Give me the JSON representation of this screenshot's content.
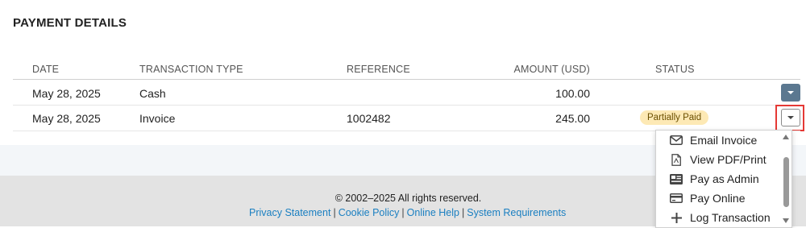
{
  "section_title": "PAYMENT DETAILS",
  "table": {
    "headers": {
      "date": "DATE",
      "transaction_type": "TRANSACTION TYPE",
      "reference": "REFERENCE",
      "amount": "AMOUNT (USD)",
      "status": "STATUS"
    },
    "rows": [
      {
        "date": "May 28, 2025",
        "transaction_type": "Cash",
        "reference": "",
        "amount": "100.00",
        "status": ""
      },
      {
        "date": "May 28, 2025",
        "transaction_type": "Invoice",
        "reference": "1002482",
        "amount": "245.00",
        "status": "Partially Paid"
      }
    ]
  },
  "dropdown_menu": {
    "items": [
      {
        "label": "Email Invoice",
        "icon": "envelope-icon"
      },
      {
        "label": "View PDF/Print",
        "icon": "pdf-file-icon"
      },
      {
        "label": "Pay as Admin",
        "icon": "admin-card-icon"
      },
      {
        "label": "Pay Online",
        "icon": "credit-card-icon"
      },
      {
        "label": "Log Transaction",
        "icon": "plus-icon"
      }
    ]
  },
  "footer": {
    "copyright": "© 2002–2025  All rights reserved.",
    "links": [
      "Privacy Statement",
      "Cookie Policy",
      "Online Help",
      "System Requirements"
    ]
  },
  "colors": {
    "accent_button": "#5b7890",
    "link": "#1a7fc1",
    "badge_bg": "#fde9b5",
    "highlight_outline": "#e53935"
  }
}
